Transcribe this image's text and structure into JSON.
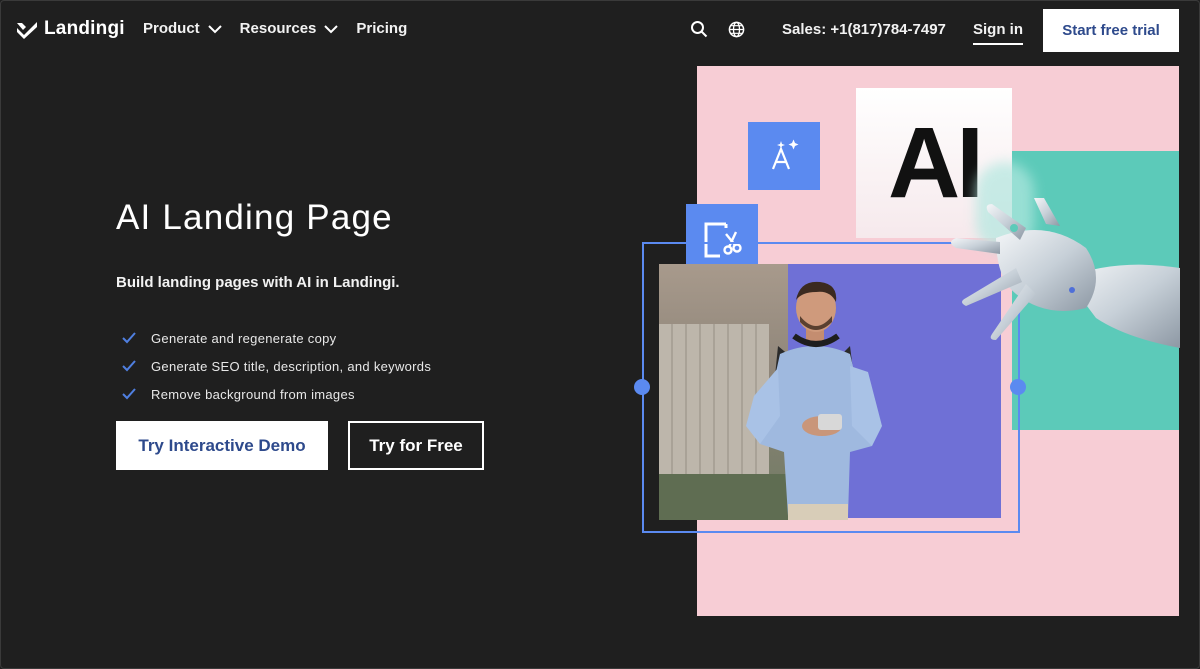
{
  "nav": {
    "logo_text": "Landingi",
    "menu": [
      {
        "label": "Product",
        "has_dropdown": true
      },
      {
        "label": "Resources",
        "has_dropdown": true
      },
      {
        "label": "Pricing",
        "has_dropdown": false
      }
    ],
    "sales": "Sales: +1(817)784-7497",
    "signin": "Sign in",
    "trial_button": "Start free trial"
  },
  "hero": {
    "title": "AI Landing Page",
    "subtitle": "Build landing pages with AI in Landingi.",
    "features": [
      "Generate and regenerate copy",
      "Generate SEO title, description, and keywords",
      "Remove background from images"
    ],
    "primary_button": "Try Interactive Demo",
    "secondary_button": "Try for Free"
  },
  "illustration": {
    "ai_label": "AI"
  },
  "colors": {
    "background": "#1f1f1f",
    "brand_blue": "#2e4a8c",
    "accent_blue": "#5b8af0",
    "pink": "#f7cdd5",
    "teal": "#5ccab9",
    "purple": "#6f70d6"
  }
}
